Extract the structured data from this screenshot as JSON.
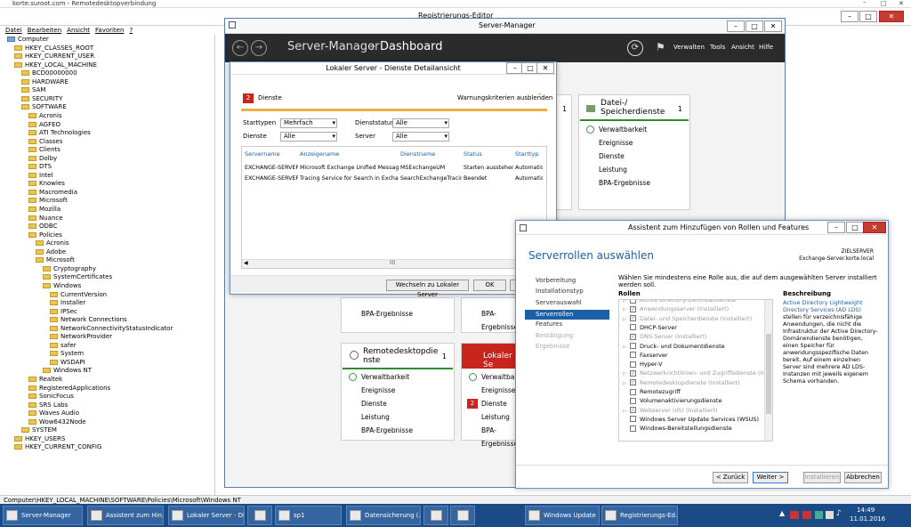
{
  "rdp": {
    "title": "korte.suroot.com - Remotedesktopverbindung"
  },
  "registry": {
    "title": "Registrierungs-Editor",
    "menu": [
      "Datei",
      "Bearbeiten",
      "Ansicht",
      "Favoriten",
      "?"
    ],
    "tree": [
      {
        "label": "Computer",
        "indent": 0
      },
      {
        "label": "HKEY_CLASSES_ROOT",
        "indent": 1
      },
      {
        "label": "HKEY_CURRENT_USER",
        "indent": 1
      },
      {
        "label": "HKEY_LOCAL_MACHINE",
        "indent": 1
      },
      {
        "label": "BCD00000000",
        "indent": 2
      },
      {
        "label": "HARDWARE",
        "indent": 2
      },
      {
        "label": "SAM",
        "indent": 2
      },
      {
        "label": "SECURITY",
        "indent": 2
      },
      {
        "label": "SOFTWARE",
        "indent": 2
      },
      {
        "label": "Acronis",
        "indent": 3
      },
      {
        "label": "AGFEO",
        "indent": 3
      },
      {
        "label": "ATI Technologies",
        "indent": 3
      },
      {
        "label": "Classes",
        "indent": 3
      },
      {
        "label": "Clients",
        "indent": 3
      },
      {
        "label": "Dolby",
        "indent": 3
      },
      {
        "label": "DTS",
        "indent": 3
      },
      {
        "label": "Intel",
        "indent": 3
      },
      {
        "label": "Knowles",
        "indent": 3
      },
      {
        "label": "Macromedia",
        "indent": 3
      },
      {
        "label": "Microsoft",
        "indent": 3
      },
      {
        "label": "Mozilla",
        "indent": 3
      },
      {
        "label": "Nuance",
        "indent": 3
      },
      {
        "label": "ODBC",
        "indent": 3
      },
      {
        "label": "Policies",
        "indent": 3
      },
      {
        "label": "Acronis",
        "indent": 4
      },
      {
        "label": "Adobe",
        "indent": 4
      },
      {
        "label": "Microsoft",
        "indent": 4
      },
      {
        "label": "Cryptography",
        "indent": 5
      },
      {
        "label": "SystemCertificates",
        "indent": 5
      },
      {
        "label": "Windows",
        "indent": 5
      },
      {
        "label": "CurrentVersion",
        "indent": 6
      },
      {
        "label": "Installer",
        "indent": 6
      },
      {
        "label": "IPSec",
        "indent": 6
      },
      {
        "label": "Network Connections",
        "indent": 6
      },
      {
        "label": "NetworkConnectivityStatusIndicator",
        "indent": 6
      },
      {
        "label": "NetworkProvider",
        "indent": 6
      },
      {
        "label": "safer",
        "indent": 6
      },
      {
        "label": "System",
        "indent": 6
      },
      {
        "label": "WSDAPI",
        "indent": 6
      },
      {
        "label": "Windows NT",
        "indent": 5
      },
      {
        "label": "Realtek",
        "indent": 3
      },
      {
        "label": "RegisteredApplications",
        "indent": 3
      },
      {
        "label": "SonicFocus",
        "indent": 3
      },
      {
        "label": "SRS Labs",
        "indent": 3
      },
      {
        "label": "Waves Audio",
        "indent": 3
      },
      {
        "label": "Wow6432Node",
        "indent": 3
      },
      {
        "label": "SYSTEM",
        "indent": 2
      },
      {
        "label": "HKEY_USERS",
        "indent": 1
      },
      {
        "label": "HKEY_CURRENT_CONFIG",
        "indent": 1
      }
    ],
    "status": "Computer\\HKEY_LOCAL_MACHINE\\SOFTWARE\\Policies\\Microsoft\\Windows NT"
  },
  "server_manager": {
    "window_title": "Server-Manager",
    "breadcrumb_app": "Server-Manager",
    "breadcrumb_sep": "›",
    "breadcrumb_page": "Dashboard",
    "menu": [
      "Verwalten",
      "Tools",
      "Ansicht",
      "Hilfe"
    ],
    "card_file": {
      "title": "Datei-/ Speicherdienste",
      "count": "1",
      "items": [
        "Verwaltbarkeit",
        "Ereignisse",
        "Dienste",
        "Leistung",
        "BPA-Ergebnisse"
      ]
    },
    "card_rds": {
      "title": "Remotedesktopdienste",
      "count": "1",
      "items": [
        "Verwaltbarkeit",
        "Ereignisse",
        "Dienste",
        "Leistung",
        "BPA-Ergebnisse"
      ]
    },
    "card_local": {
      "title": "Lokaler Se",
      "items": [
        "Verwaltbarkeit",
        "Ereignisse",
        "Dienste",
        "Leistung",
        "BPA-Ergebnisse"
      ],
      "dienste_badge": "2"
    },
    "card_left_bpa": "BPA-Ergebnisse",
    "card_mid_bpa": "BPA-Ergebnisse",
    "card_top_count": "1"
  },
  "services_dialog": {
    "title": "Lokaler Server - Dienste Detailansicht",
    "badge": "2",
    "label": "Dienste",
    "hide_criteria": "Warnungskriterien ausblenden",
    "filters": [
      {
        "label": "Starttypen",
        "value": "Mehrfach"
      },
      {
        "label": "Dienststatus",
        "value": "Alle"
      },
      {
        "label": "Dienste",
        "value": "Alle"
      },
      {
        "label": "Server",
        "value": "Alle"
      }
    ],
    "columns": [
      "Servername",
      "Anzeigename",
      "Dienstname",
      "Status",
      "Starttyp"
    ],
    "rows": [
      [
        "EXCHANGE-SERVER",
        "Microsoft Exchange Unified Messaging",
        "MSExchangeUM",
        "Starten ausstehend",
        "Automatisc"
      ],
      [
        "EXCHANGE-SERVER",
        "Tracing Service for Search in Exchange",
        "SearchExchangeTracing",
        "Beendet",
        "Automatisc"
      ]
    ],
    "btn_goto": "Wechseln zu Lokaler Server",
    "btn_ok": "OK"
  },
  "wizard": {
    "title": "Assistent zum Hinzufügen von Rollen und Features",
    "heading": "Serverrollen auswählen",
    "target_label": "ZIELSERVER",
    "target_value": "Exchange-Server.korte.local",
    "instruction": "Wählen Sie mindestens eine Rolle aus, die auf dem ausgewählten Server installiert werden soll.",
    "nav": [
      "Vorbereitung",
      "Installationstyp",
      "Serverauswahl",
      "Serverrollen",
      "Features",
      "Bestätigung",
      "Ergebnisse"
    ],
    "roles_header": "Rollen",
    "desc_header": "Beschreibung",
    "roles": [
      {
        "label": "Active Directory-Zertifikatdienste",
        "state": "partial"
      },
      {
        "label": "Anwendungsserver (Installiert)",
        "state": "installed"
      },
      {
        "label": "Datei- und Speicherdienste (Installiert)",
        "state": "installed"
      },
      {
        "label": "DHCP-Server",
        "state": "none"
      },
      {
        "label": "DNS-Server (Installiert)",
        "state": "installed"
      },
      {
        "label": "Druck- und Dokumentdienste",
        "state": "none"
      },
      {
        "label": "Faxserver",
        "state": "none"
      },
      {
        "label": "Hyper-V",
        "state": "none"
      },
      {
        "label": "Netzwerkrichtlinien- und Zugriffsdienste (Installiert)",
        "state": "installed"
      },
      {
        "label": "Remotedesktopdienste (Installiert)",
        "state": "installed"
      },
      {
        "label": "Remotezugriff",
        "state": "none"
      },
      {
        "label": "Volumenaktivierungsdienste",
        "state": "none"
      },
      {
        "label": "Webserver (IIS) (Installiert)",
        "state": "installed"
      },
      {
        "label": "Windows Server Update Services (WSUS)",
        "state": "none"
      },
      {
        "label": "Windows-Bereitstellungsdienste",
        "state": "none"
      }
    ],
    "desc_link": "Active Directory Lightweight Directory Services (AD LDS)",
    "desc_text": "stellen für verzeichnisfähige Anwendungen, die nicht die Infrastruktur der Active Directory-Domänendienste benötigen, einen Speicher für anwendungsspezifische Daten bereit. Auf einem einzelnen Server sind mehrere AD LDS-Instanzen mit jeweils eigenem Schema vorhanden.",
    "btn_back": "< Zurück",
    "btn_next": "Weiter >",
    "btn_install": "Installieren",
    "btn_cancel": "Abbrechen"
  },
  "taskbar": {
    "items": [
      "Server-Manager",
      "Assistent zum Hin...",
      "Lokaler Server - Di...",
      "",
      "sp1",
      "",
      "Datensicherung (...",
      "",
      "",
      "Windows Update",
      "Registrierungs-Ed..."
    ],
    "time": "14:49",
    "date": "11.01.2016"
  }
}
